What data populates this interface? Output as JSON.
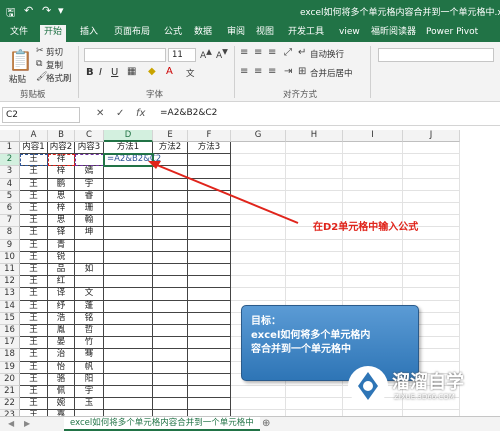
{
  "titlebar": {
    "doc_title": "excel如何将多个单元格内容合并到一个单元格中.xlsx",
    "save_icon": "save-icon",
    "undo_icon": "undo-icon",
    "redo_icon": "redo-icon"
  },
  "ribbon_tabs": [
    "文件",
    "开始",
    "插入",
    "页面布局",
    "公式",
    "数据",
    "审阅",
    "视图",
    "开发工具",
    "view",
    "福昕阅读器",
    "Power Pivot"
  ],
  "active_tab": "开始",
  "ribbon": {
    "paste_label": "粘贴",
    "cut_label": "剪切",
    "copy_label": "复制",
    "format_painter_label": "格式刷",
    "clipboard_group": "剪贴板",
    "font_size": "11",
    "font_group": "字体",
    "bold": "B",
    "italic": "I",
    "underline": "U",
    "wrap_label": "自动换行",
    "merge_label": "合并后居中",
    "align_group": "对齐方式",
    "wen": "文"
  },
  "formula_bar": {
    "name_box": "C2",
    "cancel_icon": "✕",
    "enter_icon": "✓",
    "fx_label": "fx",
    "formula": "=A2&B2&C2"
  },
  "columns": [
    "A",
    "B",
    "C",
    "D",
    "E",
    "F",
    "G",
    "H",
    "I",
    "J"
  ],
  "header_row": [
    "内容1",
    "内容2",
    "内容3",
    "方法1",
    "方法2",
    "方法3"
  ],
  "rows": [
    [
      "王",
      "祥",
      "",
      "=A2&B2&C2"
    ],
    [
      "王",
      "梓",
      "嫣",
      ""
    ],
    [
      "王",
      "鹏",
      "宇",
      ""
    ],
    [
      "王",
      "思",
      "睿",
      ""
    ],
    [
      "王",
      "梓",
      "珊",
      ""
    ],
    [
      "王",
      "思",
      "翰",
      ""
    ],
    [
      "王",
      "铎",
      "坤",
      ""
    ],
    [
      "王",
      "青",
      "",
      ""
    ],
    [
      "王",
      "锐",
      "",
      ""
    ],
    [
      "王",
      "品",
      "如",
      ""
    ],
    [
      "王",
      "红",
      "",
      ""
    ],
    [
      "王",
      "译",
      "文",
      ""
    ],
    [
      "王",
      "纾",
      "蓬",
      ""
    ],
    [
      "王",
      "浩",
      "铭",
      ""
    ],
    [
      "王",
      "胤",
      "哲",
      ""
    ],
    [
      "王",
      "晏",
      "竹",
      ""
    ],
    [
      "王",
      "治",
      "骞",
      ""
    ],
    [
      "王",
      "怡",
      "帆",
      ""
    ],
    [
      "王",
      "骆",
      "阳",
      ""
    ],
    [
      "王",
      "佩",
      "宇",
      ""
    ],
    [
      "王",
      "婉",
      "玉",
      ""
    ],
    [
      "王",
      "嘉",
      "",
      ""
    ]
  ],
  "annotation": {
    "note": "在D2单元格中输入公式",
    "goal_title": "目标：",
    "goal_line1": "excel如何将多个单元格内",
    "goal_line2": "容合并到一个单元格中",
    "accent_red": "#e0241b",
    "box_blue": "#2e75b6"
  },
  "watermark": {
    "brand": "溜溜自学",
    "url": "ZIXUE.3D66.COM"
  },
  "sheet": {
    "tab_label": "excel如何将多个单元格内容合并到一个单元格中",
    "add_icon": "⊕"
  },
  "colors": {
    "excel_green": "#217346",
    "marquee_blue": "#2f5597",
    "marquee_red": "#e0241b",
    "marquee_purple": "#7030a0"
  }
}
